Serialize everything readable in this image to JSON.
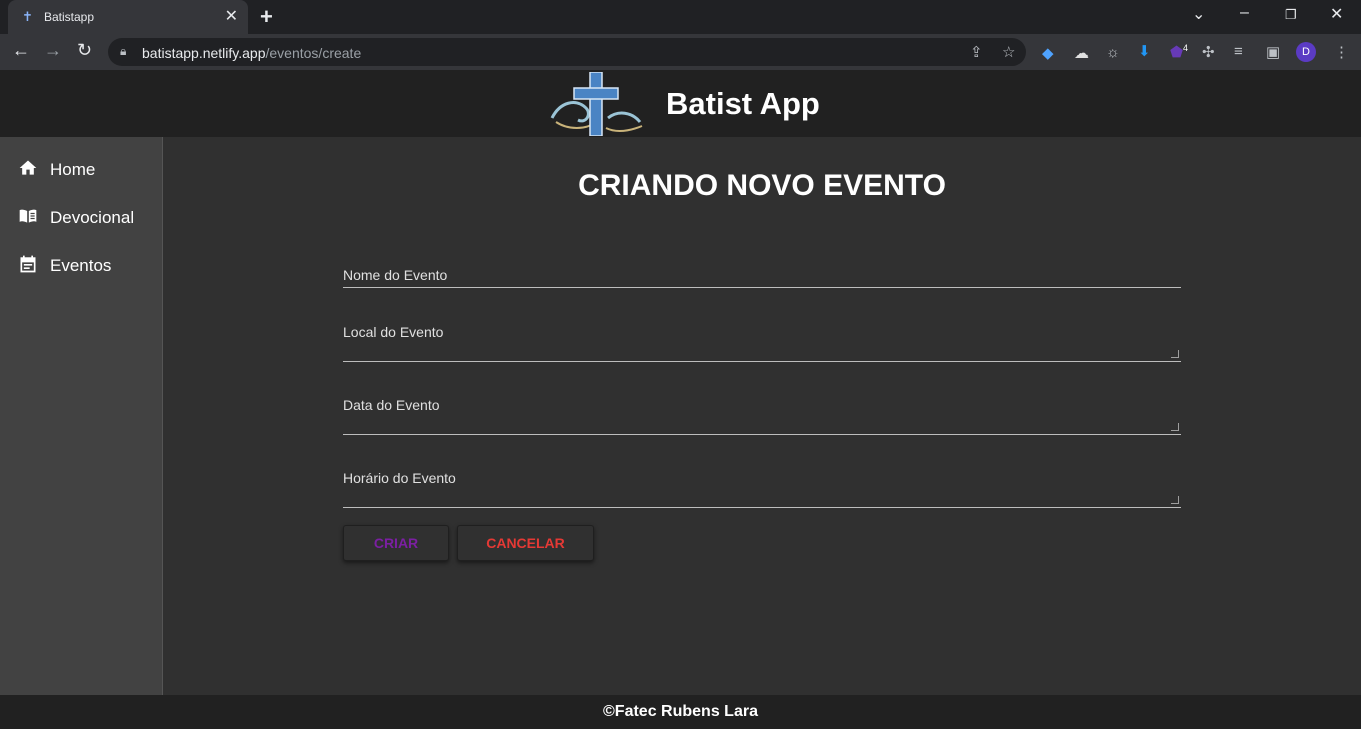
{
  "browser": {
    "tab_title": "Batistapp",
    "url_host": "batistapp.netlify.app",
    "url_path": "/eventos/create",
    "profile_initial": "D",
    "ext_badge": "4"
  },
  "app": {
    "title": "Batist App"
  },
  "sidebar": {
    "items": [
      {
        "label": "Home",
        "icon": "home-icon"
      },
      {
        "label": "Devocional",
        "icon": "book-icon"
      },
      {
        "label": "Eventos",
        "icon": "event-icon"
      }
    ]
  },
  "form": {
    "heading": "CRIANDO NOVO EVENTO",
    "fields": [
      {
        "label": "Nome do Evento"
      },
      {
        "label": "Local do Evento"
      },
      {
        "label": "Data do Evento"
      },
      {
        "label": "Horário do Evento"
      }
    ],
    "create_label": "CRIAR",
    "cancel_label": "CANCELAR",
    "create_color": "#7b1fa2",
    "cancel_color": "#e53935"
  },
  "footer": {
    "text": "©Fatec Rubens Lara"
  }
}
